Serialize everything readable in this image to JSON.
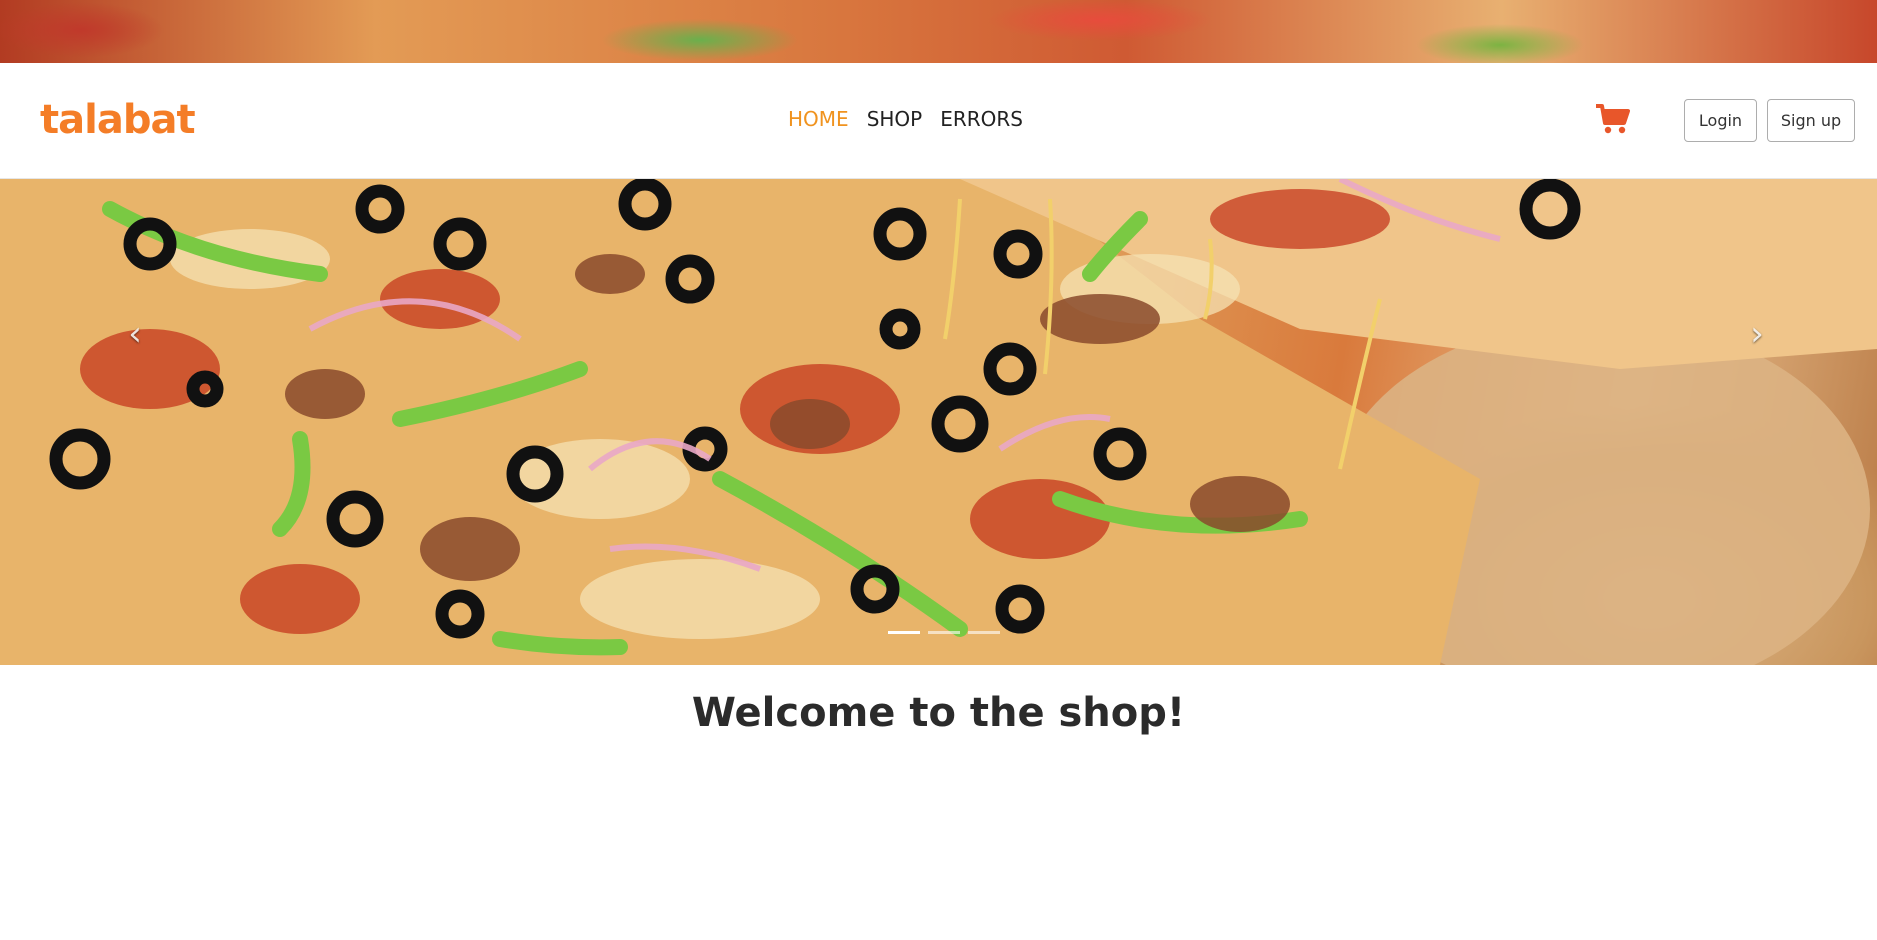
{
  "brand": {
    "logo_text": "talabat",
    "accent": "#f47d27"
  },
  "nav": {
    "items": [
      {
        "label": "HOME",
        "active": true
      },
      {
        "label": "SHOP",
        "active": false
      },
      {
        "label": "ERRORS",
        "active": false
      }
    ],
    "active_color": "#f0931f"
  },
  "header_actions": {
    "cart_icon": "shopping-cart-icon",
    "cart_color": "#e8562a",
    "login_label": "Login",
    "signup_label": "Sign up"
  },
  "carousel": {
    "prev_icon": "chevron-left-icon",
    "next_icon": "chevron-right-icon",
    "prev_glyph": "‹",
    "next_glyph": "›",
    "slide_count": 3,
    "active_slide": 1
  },
  "main": {
    "welcome_text": "Welcome to the shop!"
  }
}
